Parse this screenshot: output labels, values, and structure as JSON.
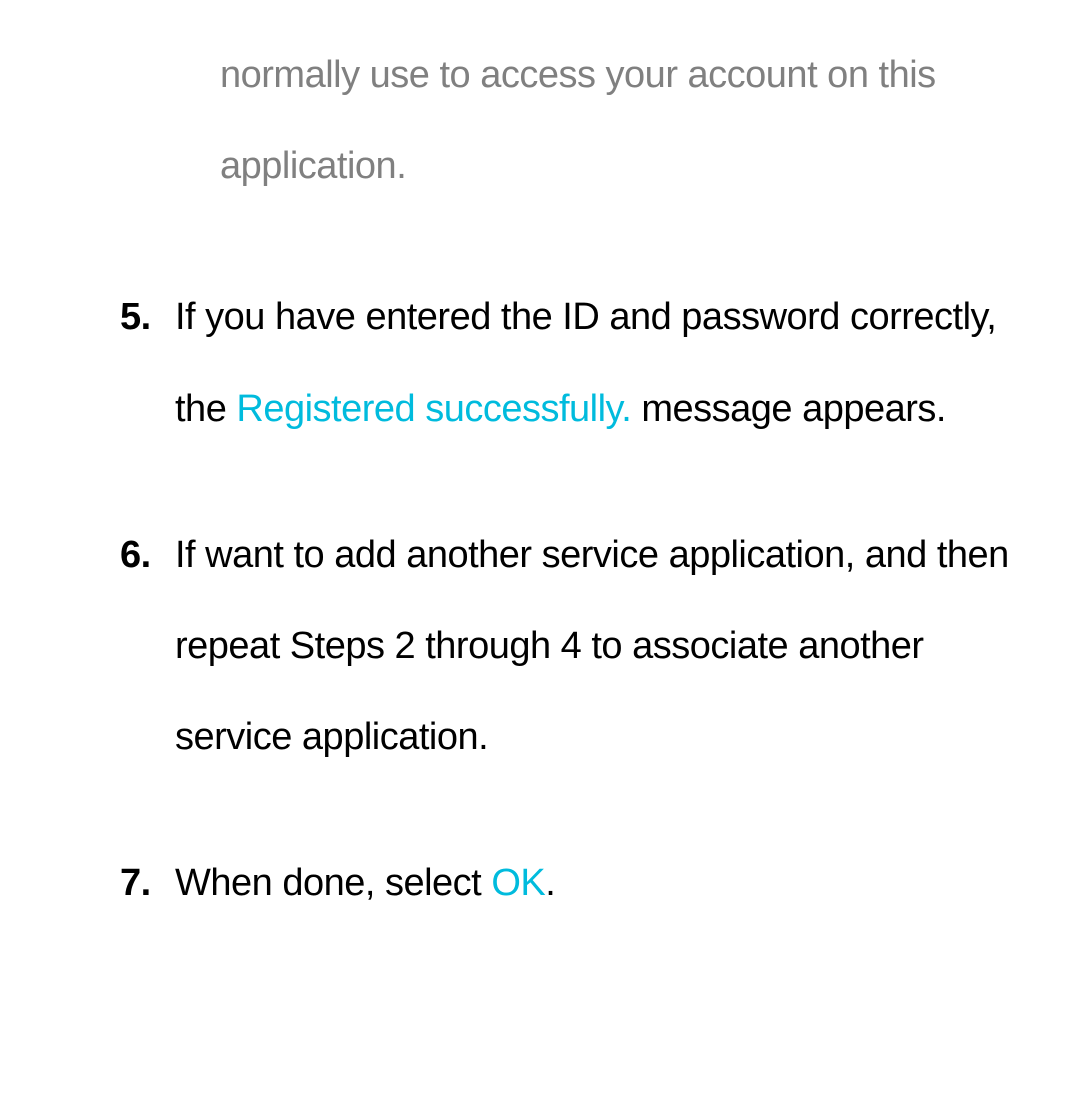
{
  "note": {
    "text": "normally use to access your account on this application."
  },
  "items": [
    {
      "number": "5.",
      "text_before": "If you have entered the ID and password correctly, the ",
      "highlighted": "Registered successfully.",
      "text_after": " message appears."
    },
    {
      "number": "6.",
      "text_before": "If want to add another service application, and then repeat Steps 2 through 4 to associate another service application.",
      "highlighted": "",
      "text_after": ""
    },
    {
      "number": "7.",
      "text_before": "When done, select ",
      "highlighted": "OK",
      "text_after": "."
    }
  ]
}
